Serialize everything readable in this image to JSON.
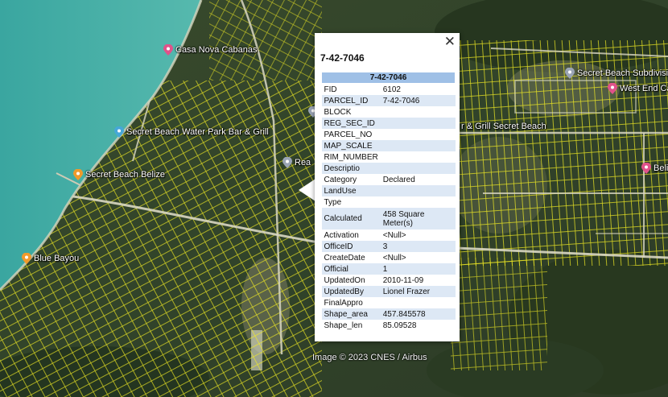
{
  "map": {
    "places": [
      {
        "name": "Casa Nova Cabanas",
        "pin_color": "#e0528a",
        "icon": "pink-pin"
      },
      {
        "name": "Secret Beach Water Park Bar & Grill",
        "pin_color": "#46a7d8",
        "icon": "blue-pin"
      },
      {
        "name": "Secret Beach Belize",
        "pin_color": "#f09a2b",
        "icon": "orange-pin"
      },
      {
        "name": "Blue Bayou",
        "pin_color": "#f09a2b",
        "icon": "orange-pin"
      },
      {
        "name": "Rea",
        "pin_color": "#9aa4b5",
        "icon": "gray-pin"
      },
      {
        "name": "Secret Beach Subdivision",
        "pin_color": "#9aa4b5",
        "icon": "gray-pin"
      },
      {
        "name": "West End Cab",
        "pin_color": "#e0528a",
        "icon": "pink-pin"
      },
      {
        "name": "r & Grill Secret Beach",
        "pin_color": "",
        "icon": ""
      },
      {
        "name": "Beliz",
        "pin_color": "#e0528a",
        "icon": "pink-pin"
      }
    ],
    "attribution": "Image © 2023 CNES / Airbus",
    "parcel_line_color": "#f4ee22"
  },
  "popup": {
    "close_symbol": "✕",
    "title": "7-42-7046",
    "table_header": "7-42-7046",
    "rows": [
      {
        "key": "FID",
        "value": "6102"
      },
      {
        "key": "PARCEL_ID",
        "value": "7-42-7046"
      },
      {
        "key": "BLOCK",
        "value": ""
      },
      {
        "key": "REG_SEC_ID",
        "value": ""
      },
      {
        "key": "PARCEL_NO",
        "value": ""
      },
      {
        "key": "MAP_SCALE",
        "value": ""
      },
      {
        "key": "RIM_NUMBER",
        "value": ""
      },
      {
        "key": "Descriptio",
        "value": ""
      },
      {
        "key": "Category",
        "value": "Declared"
      },
      {
        "key": "LandUse",
        "value": ""
      },
      {
        "key": "Type",
        "value": ""
      },
      {
        "key": "Calculated",
        "value": "458 Square Meter(s)"
      },
      {
        "key": "Activation",
        "value": "<Null>"
      },
      {
        "key": "OfficeID",
        "value": "3"
      },
      {
        "key": "CreateDate",
        "value": "<Null>"
      },
      {
        "key": "Official",
        "value": "1"
      },
      {
        "key": "UpdatedOn",
        "value": "2010-11-09"
      },
      {
        "key": "UpdatedBy",
        "value": "Lionel Frazer"
      },
      {
        "key": "FinalAppro",
        "value": ""
      },
      {
        "key": "Shape_area",
        "value": "457.845578"
      },
      {
        "key": "Shape_len",
        "value": "85.09528"
      }
    ]
  }
}
